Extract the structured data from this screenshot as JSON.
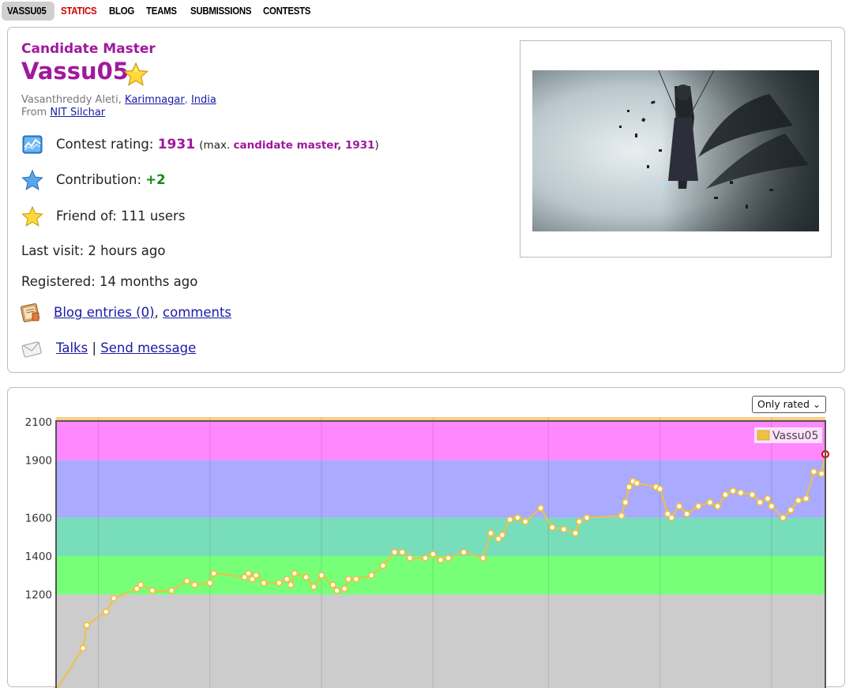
{
  "nav": {
    "items": [
      {
        "label": "VASSU05",
        "state": "active"
      },
      {
        "label": "STATICS",
        "state": "red"
      },
      {
        "label": "BLOG",
        "state": "normal"
      },
      {
        "label": "TEAMS",
        "state": "normal"
      },
      {
        "label": "SUBMISSIONS",
        "state": "normal"
      },
      {
        "label": "CONTESTS",
        "state": "normal"
      }
    ]
  },
  "profile": {
    "rank": "Candidate Master",
    "handle": "Vassu05",
    "name": "Vasanthreddy Aleti, ",
    "city": "Karimnagar",
    "sep": ", ",
    "country": "India",
    "from_label": "From ",
    "org": "NIT Silchar",
    "rating_label": "Contest rating: ",
    "rating": "1931",
    "max_prefix": "(max. ",
    "max_rank": "candidate master, 1931",
    "max_suffix": ")",
    "contribution_label": "Contribution: ",
    "contribution": "+2",
    "friend_label": "Friend of: ",
    "friend_count": "111 users",
    "last_visit": "Last visit: 2 hours ago",
    "registered": "Registered: 14 months ago",
    "blog_link": "Blog entries (0)",
    "comma": ", ",
    "comments_link": "comments",
    "talks_link": "Talks",
    "pipe": " | ",
    "send_link": "Send message"
  },
  "colors": {
    "candidate_master": "#a0189e",
    "positive": "#148a14",
    "link": "#1a1aa6"
  },
  "icons": {
    "rank_star": "star-icon",
    "rating": "rating-graph-icon",
    "contribution": "blue-star-icon",
    "friend": "gold-star-icon",
    "blog": "blog-icon",
    "talks": "envelope-icon"
  },
  "filter": {
    "selected": "Only rated"
  },
  "chart_data": {
    "type": "line",
    "series": [
      {
        "name": "Vassu05",
        "color": "#edc240"
      }
    ],
    "y_ticks": [
      1200,
      1400,
      1600,
      1900,
      2100
    ],
    "ylim": [
      700,
      2100
    ],
    "bands": [
      {
        "from": 0,
        "to": 1200,
        "color": "#cccccc"
      },
      {
        "from": 1200,
        "to": 1400,
        "color": "#77ff77"
      },
      {
        "from": 1400,
        "to": 1600,
        "color": "#77ddbb"
      },
      {
        "from": 1600,
        "to": 1900,
        "color": "#aaaaff"
      },
      {
        "from": 1900,
        "to": 2100,
        "color": "#ff88ff"
      },
      {
        "from": 2100,
        "to": 2400,
        "color": "#ffcc88"
      }
    ],
    "points": [
      [
        0.0,
        700
      ],
      [
        0.035,
        920
      ],
      [
        0.04,
        1040
      ],
      [
        0.065,
        1110
      ],
      [
        0.075,
        1180
      ],
      [
        0.105,
        1230
      ],
      [
        0.11,
        1250
      ],
      [
        0.125,
        1220
      ],
      [
        0.15,
        1220
      ],
      [
        0.17,
        1270
      ],
      [
        0.18,
        1250
      ],
      [
        0.2,
        1260
      ],
      [
        0.205,
        1310
      ],
      [
        0.245,
        1290
      ],
      [
        0.25,
        1310
      ],
      [
        0.255,
        1280
      ],
      [
        0.26,
        1300
      ],
      [
        0.27,
        1260
      ],
      [
        0.29,
        1260
      ],
      [
        0.3,
        1280
      ],
      [
        0.305,
        1250
      ],
      [
        0.31,
        1310
      ],
      [
        0.325,
        1290
      ],
      [
        0.335,
        1240
      ],
      [
        0.345,
        1300
      ],
      [
        0.36,
        1250
      ],
      [
        0.365,
        1220
      ],
      [
        0.375,
        1230
      ],
      [
        0.38,
        1280
      ],
      [
        0.39,
        1280
      ],
      [
        0.41,
        1300
      ],
      [
        0.425,
        1350
      ],
      [
        0.44,
        1420
      ],
      [
        0.45,
        1420
      ],
      [
        0.46,
        1390
      ],
      [
        0.48,
        1390
      ],
      [
        0.49,
        1410
      ],
      [
        0.5,
        1380
      ],
      [
        0.51,
        1390
      ],
      [
        0.53,
        1420
      ],
      [
        0.555,
        1390
      ],
      [
        0.565,
        1520
      ],
      [
        0.575,
        1490
      ],
      [
        0.58,
        1510
      ],
      [
        0.59,
        1590
      ],
      [
        0.6,
        1600
      ],
      [
        0.61,
        1580
      ],
      [
        0.63,
        1650
      ],
      [
        0.645,
        1550
      ],
      [
        0.66,
        1540
      ],
      [
        0.675,
        1520
      ],
      [
        0.68,
        1580
      ],
      [
        0.69,
        1600
      ],
      [
        0.735,
        1610
      ],
      [
        0.74,
        1680
      ],
      [
        0.745,
        1760
      ],
      [
        0.75,
        1790
      ],
      [
        0.755,
        1780
      ],
      [
        0.78,
        1760
      ],
      [
        0.785,
        1750
      ],
      [
        0.795,
        1620
      ],
      [
        0.8,
        1600
      ],
      [
        0.81,
        1660
      ],
      [
        0.82,
        1620
      ],
      [
        0.835,
        1660
      ],
      [
        0.85,
        1680
      ],
      [
        0.86,
        1660
      ],
      [
        0.87,
        1720
      ],
      [
        0.88,
        1740
      ],
      [
        0.89,
        1730
      ],
      [
        0.905,
        1720
      ],
      [
        0.915,
        1680
      ],
      [
        0.925,
        1700
      ],
      [
        0.93,
        1660
      ],
      [
        0.945,
        1600
      ],
      [
        0.955,
        1640
      ],
      [
        0.965,
        1690
      ],
      [
        0.975,
        1700
      ],
      [
        0.985,
        1840
      ],
      [
        0.995,
        1830
      ],
      [
        1.0,
        1931
      ]
    ]
  }
}
